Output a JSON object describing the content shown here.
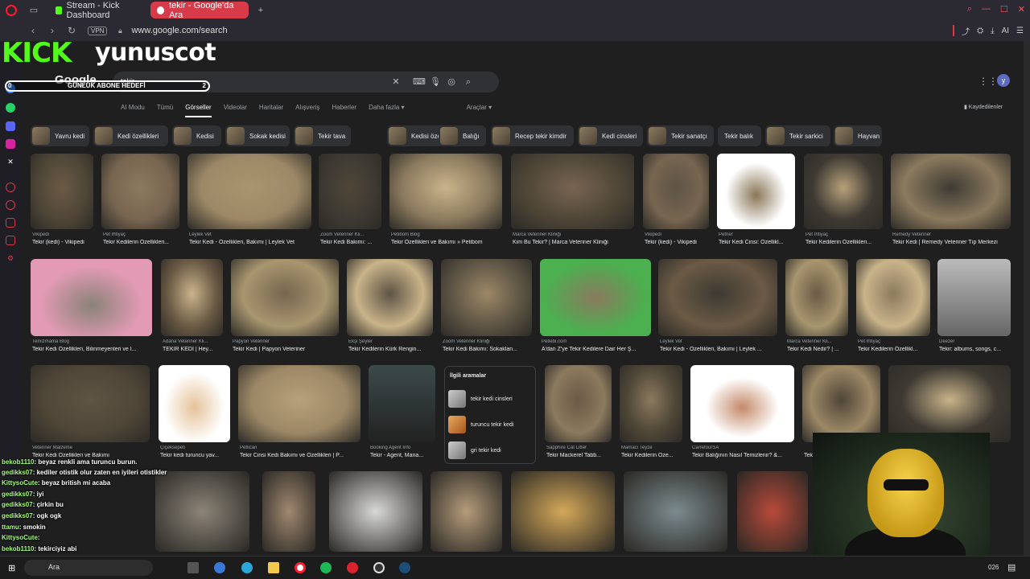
{
  "browser": {
    "tabs": [
      {
        "label": "Stream - Kick Dashboard",
        "active": false
      },
      {
        "label": "tekir - Google'da Ara",
        "active": true
      }
    ],
    "vpn_label": "VPN",
    "url": "www.google.com/search",
    "ai_label": "AI"
  },
  "google": {
    "logo": "Google",
    "query": "tekir",
    "tabs": [
      "AI Modu",
      "Tümü",
      "Görseller",
      "Videolar",
      "Haritalar",
      "Alışveriş",
      "Haberler",
      "Daha fazla",
      "Araçlar"
    ],
    "selected_tab": "Görseller",
    "saved_label": "Kaydedilenler",
    "avatar_letter": "y",
    "chips": [
      "Yavru kedi",
      "Kedi özellikleri",
      "Kedisi",
      "Sokak kedisi",
      "Tekir tava",
      "Kedisi özellikleri",
      "Balığı",
      "Recep tekir kimdir",
      "Kedi cinsleri",
      "Tekir sanatçı",
      "Tekir balık",
      "Tekir sarkici",
      "Hayvan"
    ],
    "rows": [
      [
        {
          "src": "Vikipedi",
          "title": "Tekir (kedi) - Vikipedi"
        },
        {
          "src": "Pet İhtiyaç",
          "title": "Tekir Kedilerin Özellikleri..."
        },
        {
          "src": "Leylek Vet",
          "title": "Tekir Kedi - Özellikleri, Bakımı | Leylek Vet"
        },
        {
          "src": "Zoom Veteriner Kli...",
          "title": "Tekir Kedi Bakımı: ..."
        },
        {
          "src": "Petibom Blog",
          "title": "Tekir Özellikleri ve Bakımı » Petibom"
        },
        {
          "src": "Marca Veteriner Kliniği",
          "title": "Kim Bu Tekir? | Marca Veteriner Kliniği"
        },
        {
          "src": "Vikipedi",
          "title": "Tekir (kedi) - Vikipedi"
        },
        {
          "src": "Petner",
          "title": "Tekir Kedi Cinsi: Özellikl..."
        },
        {
          "src": "Pet İhtiyaç",
          "title": "Tekir Kedilerin Özellikleri..."
        },
        {
          "src": "Remedy Veteriner",
          "title": "Tekir Kedi | Remedy Veteriner Tıp Merkezi"
        }
      ],
      [
        {
          "src": "Temizmama Blog",
          "title": "Tekir Kedi Özellikleri, Bilinmeyenleri ve I..."
        },
        {
          "src": "Adana Veteriner Kli...",
          "title": "TEKİR KEDİ | Hey..."
        },
        {
          "src": "Papyon Veteriner",
          "title": "Tekir Kedi | Papyon Veteriner"
        },
        {
          "src": "Ekşi Şeyler",
          "title": "Tekir Kedilerin Kürk Rengin..."
        },
        {
          "src": "Zoom Veteriner Kliniği",
          "title": "Tekir Kedi Bakımı: Sokaklan..."
        },
        {
          "src": "Petlebi.com",
          "title": "A'dan Z'ye Tekir Kedilere Dair Her Ş..."
        },
        {
          "src": "Leylek Vet",
          "title": "Tekir Kedi - Özellikleri, Bakımı | Leylek ..."
        },
        {
          "src": "Marca Veteriner Kli...",
          "title": "Tekir Kedi Nedir? | ..."
        },
        {
          "src": "Pet İhtiyaç",
          "title": "Tekir Kedilerin Özellikl..."
        },
        {
          "src": "Deezer",
          "title": "Tekir: albums, songs, c..."
        }
      ],
      [
        {
          "src": "Veteriner Malzeme",
          "title": "Tekir Kedi Özellikleri ve Bakımı"
        },
        {
          "src": "Çiçeksepeti",
          "title": "Tekir kedi turuncu yav..."
        },
        {
          "src": "Petlican",
          "title": "Tekir Cinsi Kedi Bakımı ve Özellikleri | P..."
        },
        {
          "src": "Booking Agent Info",
          "title": "Tekir - Agent, Mana..."
        },
        {
          "src": "Sapphire Cat Litter",
          "title": "Tekir Mackerel Tabb..."
        },
        {
          "src": "Mamacı Teyze",
          "title": "Tekir Kedilerin Öze..."
        },
        {
          "src": "CarrefourSA",
          "title": "Tekir Balığının Nasıl Temizlenir? &..."
        },
        {
          "src": "",
          "title": "Tekir..."
        },
        {
          "src": "",
          "title": "...akter..."
        }
      ]
    ],
    "related": {
      "title": "İlgili aramalar",
      "items": [
        "tekir kedi cinsleri",
        "turuncu tekir kedi",
        "gri tekir kedi"
      ]
    }
  },
  "overlay": {
    "brand": "KICK",
    "streamer": "yunuscot",
    "goal": {
      "label": "GÜNLÜK ABONE HEDEFİ",
      "current": "0",
      "target": "2",
      "progress": 0
    },
    "chat": [
      {
        "user": "bekob1110",
        "msg": "beyaz renkli ama turuncu burun."
      },
      {
        "user": "gedikks07",
        "msg": "kediler otistik olur zaten en iyileri otistikler"
      },
      {
        "user": "KittysoCute",
        "msg": "beyaz british mi acaba"
      },
      {
        "user": "gedikks07",
        "msg": "iyi"
      },
      {
        "user": "gedikks07",
        "msg": "çirkin bu"
      },
      {
        "user": "gedikks07",
        "msg": "ogk ogk"
      },
      {
        "user": "ttamu",
        "msg": "smokin"
      },
      {
        "user": "KittysoCute",
        "msg": ""
      },
      {
        "user": "bekob1110",
        "msg": "tekirciyiz abi"
      }
    ]
  },
  "taskbar": {
    "search_label": "Ara",
    "clock": "026"
  }
}
